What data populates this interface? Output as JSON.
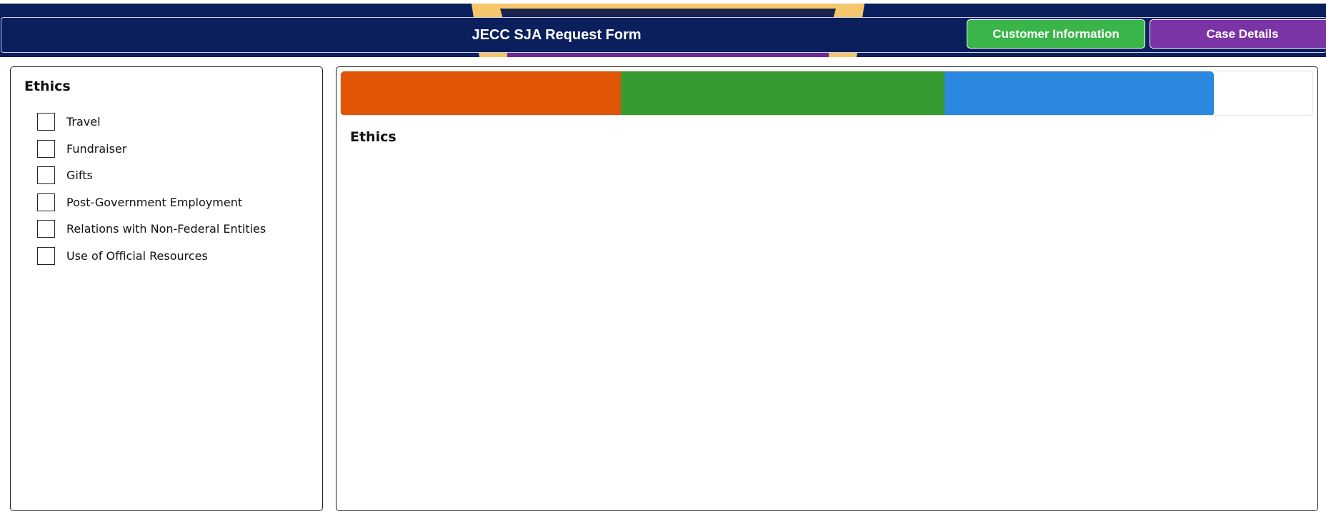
{
  "header": {
    "title": "JECC SJA Request Form",
    "nav": [
      {
        "label": "Customer Information",
        "color": "#39b54a"
      },
      {
        "label": "Case Details",
        "color": "#7b34a6"
      }
    ],
    "background_color": "#0a1f5c"
  },
  "left_panel": {
    "title": "Ethics",
    "checkboxes": [
      {
        "label": "Travel",
        "checked": false
      },
      {
        "label": "Fundraiser",
        "checked": false
      },
      {
        "label": "Gifts",
        "checked": false
      },
      {
        "label": "Post-Government Employment",
        "checked": false
      },
      {
        "label": "Relations with Non-Federal Entities",
        "checked": false
      },
      {
        "label": "Use of Official Resources",
        "checked": false
      }
    ]
  },
  "right_panel": {
    "title": "Ethics",
    "progress": {
      "segments": [
        {
          "color": "#e05506",
          "fraction": 0.288
        },
        {
          "color": "#369b30",
          "fraction": 0.333
        },
        {
          "color": "#2a88e0",
          "fraction": 0.277
        }
      ],
      "total_filled_fraction": 0.898
    }
  }
}
